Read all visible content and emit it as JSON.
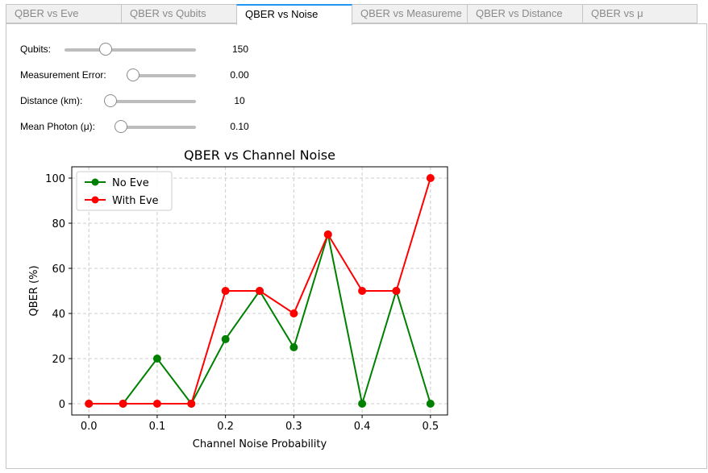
{
  "tabs": [
    {
      "label": "QBER vs Eve",
      "active": false
    },
    {
      "label": "QBER vs Qubits",
      "active": false
    },
    {
      "label": "QBER vs Noise",
      "active": true
    },
    {
      "label": "QBER vs Measureme",
      "active": false
    },
    {
      "label": "QBER vs Distance",
      "active": false
    },
    {
      "label": "QBER vs μ",
      "active": false
    }
  ],
  "sliders": [
    {
      "label": "Qubits:",
      "value": "150",
      "fraction": 0.29
    },
    {
      "label": "Measurement Error:",
      "value": "0.00",
      "fraction": 0.0
    },
    {
      "label": "Distance (km):",
      "value": "10",
      "fraction": 0.0
    },
    {
      "label": "Mean Photon (μ):",
      "value": "0.10",
      "fraction": 0.0
    }
  ],
  "colors": {
    "no_eve": "#008000",
    "with_eve": "#ff0000",
    "accent": "#2196f3"
  },
  "chart_data": {
    "type": "line",
    "title": "QBER vs Channel Noise",
    "xlabel": "Channel Noise Probability",
    "ylabel": "QBER (%)",
    "xlim": [
      -0.025,
      0.525
    ],
    "ylim": [
      -5,
      105
    ],
    "xticks": [
      "0.0",
      "0.1",
      "0.2",
      "0.3",
      "0.4",
      "0.5"
    ],
    "xtick_values": [
      0.0,
      0.1,
      0.2,
      0.3,
      0.4,
      0.5
    ],
    "yticks": [
      "0",
      "20",
      "40",
      "60",
      "80",
      "100"
    ],
    "ytick_values": [
      0,
      20,
      40,
      60,
      80,
      100
    ],
    "grid": true,
    "legend": "top-left",
    "x": [
      0.0,
      0.05,
      0.1,
      0.15,
      0.2,
      0.25,
      0.3,
      0.35,
      0.4,
      0.45,
      0.5
    ],
    "series": [
      {
        "name": "No Eve",
        "color": "#008000",
        "values": [
          0,
          0,
          20,
          0,
          28.6,
          50,
          25,
          75,
          0,
          50,
          0
        ]
      },
      {
        "name": "With Eve",
        "color": "#ff0000",
        "values": [
          0,
          0,
          0,
          0,
          50,
          50,
          40,
          75,
          50,
          50,
          100
        ]
      }
    ]
  }
}
